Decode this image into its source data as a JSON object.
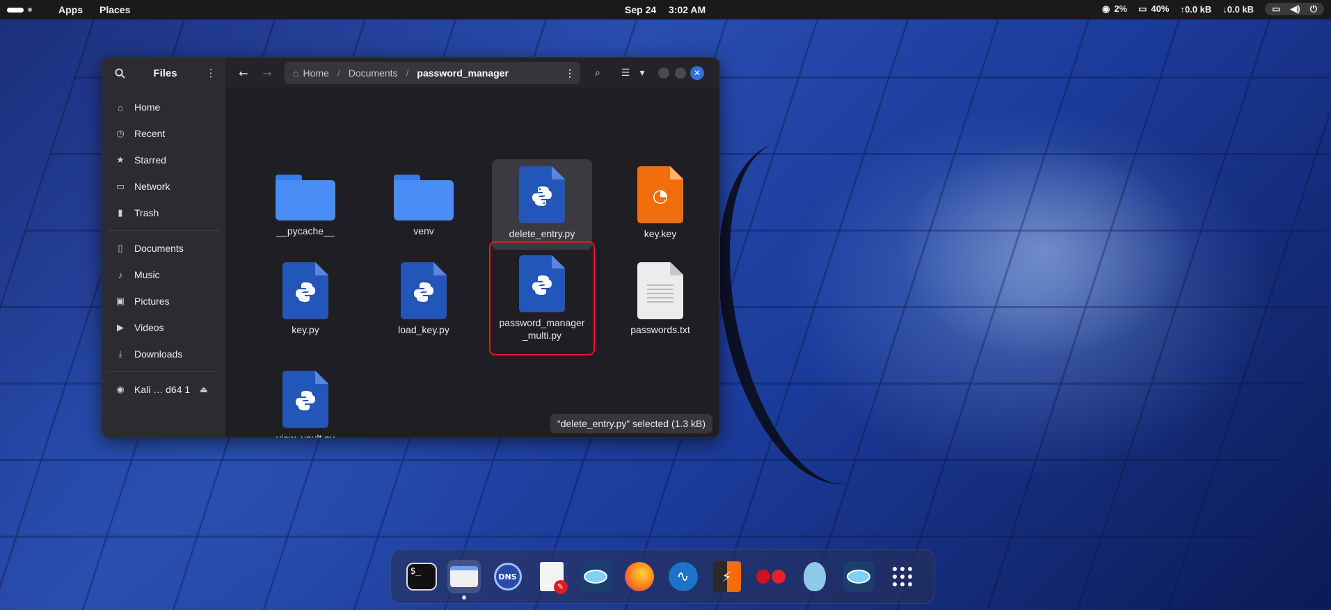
{
  "topbar": {
    "apps_label": "Apps",
    "places_label": "Places",
    "date": "Sep 24",
    "time": "3:02 AM",
    "cpu": "2%",
    "battery": "40%",
    "upload": "0.0 kB",
    "download": "0.0 kB"
  },
  "sidebar": {
    "title": "Files",
    "items": [
      {
        "label": "Home",
        "icon": "home-icon"
      },
      {
        "label": "Recent",
        "icon": "clock-icon"
      },
      {
        "label": "Starred",
        "icon": "star-icon"
      },
      {
        "label": "Network",
        "icon": "network-icon"
      },
      {
        "label": "Trash",
        "icon": "trash-icon"
      }
    ],
    "places": [
      {
        "label": "Documents",
        "icon": "document-icon"
      },
      {
        "label": "Music",
        "icon": "music-icon"
      },
      {
        "label": "Pictures",
        "icon": "picture-icon"
      },
      {
        "label": "Videos",
        "icon": "video-icon"
      },
      {
        "label": "Downloads",
        "icon": "download-icon"
      }
    ],
    "drive": {
      "label": "Kali … d64 1",
      "icon": "disc-icon"
    }
  },
  "pathbar": {
    "home": "Home",
    "documents": "Documents",
    "current": "password_manager"
  },
  "files": [
    {
      "name": "__pycache__",
      "type": "folder"
    },
    {
      "name": "venv",
      "type": "folder"
    },
    {
      "name": "delete_entry.py",
      "type": "python",
      "selected": true
    },
    {
      "name": "key.key",
      "type": "key"
    },
    {
      "name": "key.py",
      "type": "python"
    },
    {
      "name": "load_key.py",
      "type": "python"
    },
    {
      "name": "password_manager\n_multi.py",
      "type": "python",
      "highlighted": true
    },
    {
      "name": "passwords.txt",
      "type": "text"
    },
    {
      "name": "view_vault.py",
      "type": "python"
    }
  ],
  "status": {
    "text": "“delete_entry.py” selected  (1.3 kB)"
  },
  "dock": [
    {
      "name": "terminal"
    },
    {
      "name": "files",
      "active": true
    },
    {
      "name": "dns-tool"
    },
    {
      "name": "text-editor"
    },
    {
      "name": "network-tool"
    },
    {
      "name": "firefox"
    },
    {
      "name": "wireshark"
    },
    {
      "name": "burpsuite"
    },
    {
      "name": "cherrytree"
    },
    {
      "name": "maltego"
    },
    {
      "name": "network-tool-2"
    },
    {
      "name": "app-grid"
    }
  ],
  "colors": {
    "accent": "#2f6fe0",
    "highlight": "#e01b24",
    "python_icon": "#2455b8",
    "key_icon": "#f26d0d"
  }
}
